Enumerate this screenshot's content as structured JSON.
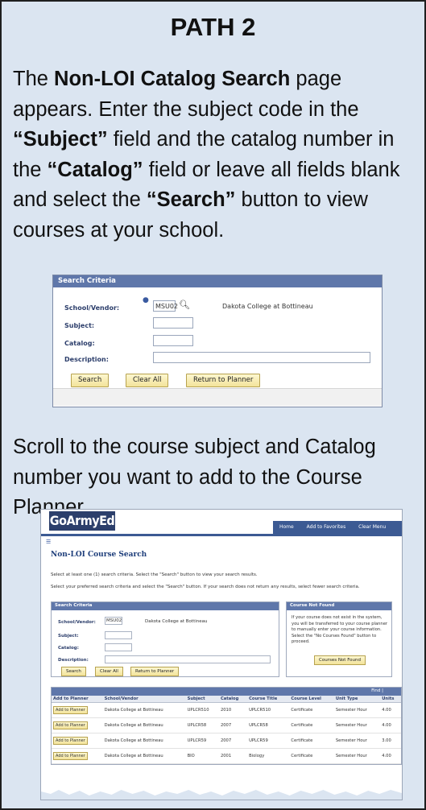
{
  "slide": {
    "title": "PATH 2",
    "para1": {
      "t1": "The ",
      "b1": "Non-LOI Catalog Search",
      "t2": " page appears. Enter the subject code in the ",
      "b2": "“Subject”",
      "t3": " field and the catalog number in the ",
      "b3": "“Catalog”",
      "t4": " field or leave all fields blank and select the ",
      "b4": "“Search”",
      "t5": " button to view courses at your school."
    },
    "para2": "Scroll to the course subject and Catalog number you want to add to the Course Planner."
  },
  "search_panel": {
    "header": "Search Criteria",
    "school_label": "School/Vendor:",
    "school_value": "MSU02",
    "school_name": "Dakota College at Bottineau",
    "subject_label": "Subject:",
    "catalog_label": "Catalog:",
    "description_label": "Description:",
    "search_button": "Search",
    "clear_button": "Clear All",
    "return_button": "Return to Planner"
  },
  "goarmyed": {
    "logo": "GoArmyEd",
    "links": [
      "Home",
      "Add to Favorites",
      "Clear Menu"
    ],
    "page_title": "Non-LOI Course Search",
    "instruction1": "Select at least one (1) search criteria. Select the \"Search\" button to view your search results.",
    "instruction2": "Select your preferred search criteria and select the \"Search\" button. If your search does not return any results, select fewer search criteria.",
    "search_criteria": {
      "header": "Search Criteria",
      "school_label": "School/Vendor:",
      "school_value": "MSU02",
      "school_name": "Dakota College at Bottineau",
      "subject_label": "Subject:",
      "catalog_label": "Catalog:",
      "description_label": "Description:",
      "search_button": "Search",
      "clear_button": "Clear All",
      "return_button": "Return to Planner"
    },
    "not_found": {
      "header": "Course Not Found",
      "text": "If your course does not exist in the system, you will be transferred to your course planner to manually enter your course information. Select the \"No Courses Found\" button to proceed.",
      "button": "Courses Not Found"
    },
    "results": {
      "find": "Find |",
      "columns": [
        "Add to Planner",
        "School/Vendor",
        "Subject",
        "Catalog",
        "Course Title",
        "Course Level",
        "Unit Type",
        "Units"
      ],
      "rows": [
        [
          "Add to Planner",
          "Dakota College at Bottineau",
          "UPLCR510",
          "2010",
          "UPLCR510",
          "Certificate",
          "Semester Hour",
          "4.00"
        ],
        [
          "Add to Planner",
          "Dakota College at Bottineau",
          "UPLCR58",
          "2007",
          "UPLCR58",
          "Certificate",
          "Semester Hour",
          "4.00"
        ],
        [
          "Add to Planner",
          "Dakota College at Bottineau",
          "UPLCR59",
          "2007",
          "UPLCR59",
          "Certificate",
          "Semester Hour",
          "3.00"
        ],
        [
          "Add to Planner",
          "Dakota College at Bottineau",
          "BIO",
          "2001",
          "Biology",
          "Certificate",
          "Semester Hour",
          "4.00"
        ]
      ]
    }
  }
}
